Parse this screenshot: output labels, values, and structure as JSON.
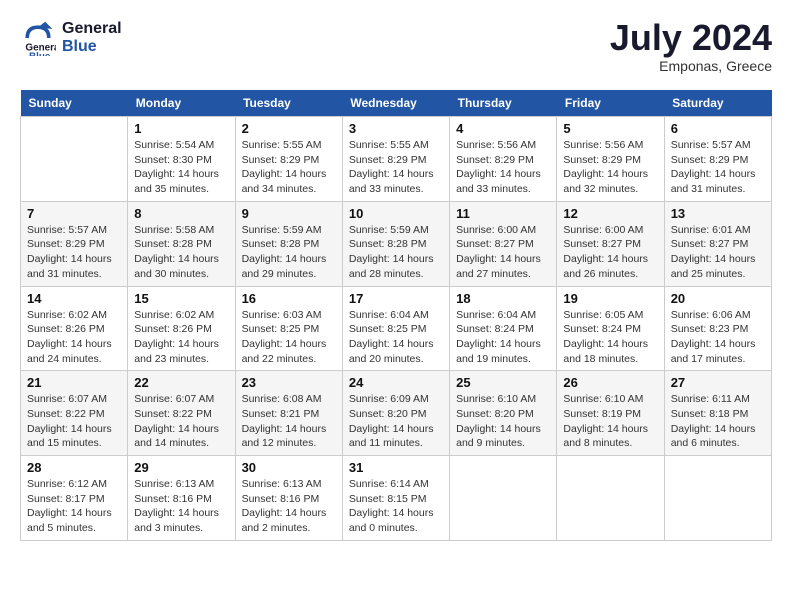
{
  "header": {
    "logo_line1": "General",
    "logo_line2": "Blue",
    "month": "July 2024",
    "location": "Emponas, Greece"
  },
  "columns": [
    "Sunday",
    "Monday",
    "Tuesday",
    "Wednesday",
    "Thursday",
    "Friday",
    "Saturday"
  ],
  "weeks": [
    [
      {
        "num": "",
        "info": ""
      },
      {
        "num": "1",
        "info": "Sunrise: 5:54 AM\nSunset: 8:30 PM\nDaylight: 14 hours\nand 35 minutes."
      },
      {
        "num": "2",
        "info": "Sunrise: 5:55 AM\nSunset: 8:29 PM\nDaylight: 14 hours\nand 34 minutes."
      },
      {
        "num": "3",
        "info": "Sunrise: 5:55 AM\nSunset: 8:29 PM\nDaylight: 14 hours\nand 33 minutes."
      },
      {
        "num": "4",
        "info": "Sunrise: 5:56 AM\nSunset: 8:29 PM\nDaylight: 14 hours\nand 33 minutes."
      },
      {
        "num": "5",
        "info": "Sunrise: 5:56 AM\nSunset: 8:29 PM\nDaylight: 14 hours\nand 32 minutes."
      },
      {
        "num": "6",
        "info": "Sunrise: 5:57 AM\nSunset: 8:29 PM\nDaylight: 14 hours\nand 31 minutes."
      }
    ],
    [
      {
        "num": "7",
        "info": "Sunrise: 5:57 AM\nSunset: 8:29 PM\nDaylight: 14 hours\nand 31 minutes."
      },
      {
        "num": "8",
        "info": "Sunrise: 5:58 AM\nSunset: 8:28 PM\nDaylight: 14 hours\nand 30 minutes."
      },
      {
        "num": "9",
        "info": "Sunrise: 5:59 AM\nSunset: 8:28 PM\nDaylight: 14 hours\nand 29 minutes."
      },
      {
        "num": "10",
        "info": "Sunrise: 5:59 AM\nSunset: 8:28 PM\nDaylight: 14 hours\nand 28 minutes."
      },
      {
        "num": "11",
        "info": "Sunrise: 6:00 AM\nSunset: 8:27 PM\nDaylight: 14 hours\nand 27 minutes."
      },
      {
        "num": "12",
        "info": "Sunrise: 6:00 AM\nSunset: 8:27 PM\nDaylight: 14 hours\nand 26 minutes."
      },
      {
        "num": "13",
        "info": "Sunrise: 6:01 AM\nSunset: 8:27 PM\nDaylight: 14 hours\nand 25 minutes."
      }
    ],
    [
      {
        "num": "14",
        "info": "Sunrise: 6:02 AM\nSunset: 8:26 PM\nDaylight: 14 hours\nand 24 minutes."
      },
      {
        "num": "15",
        "info": "Sunrise: 6:02 AM\nSunset: 8:26 PM\nDaylight: 14 hours\nand 23 minutes."
      },
      {
        "num": "16",
        "info": "Sunrise: 6:03 AM\nSunset: 8:25 PM\nDaylight: 14 hours\nand 22 minutes."
      },
      {
        "num": "17",
        "info": "Sunrise: 6:04 AM\nSunset: 8:25 PM\nDaylight: 14 hours\nand 20 minutes."
      },
      {
        "num": "18",
        "info": "Sunrise: 6:04 AM\nSunset: 8:24 PM\nDaylight: 14 hours\nand 19 minutes."
      },
      {
        "num": "19",
        "info": "Sunrise: 6:05 AM\nSunset: 8:24 PM\nDaylight: 14 hours\nand 18 minutes."
      },
      {
        "num": "20",
        "info": "Sunrise: 6:06 AM\nSunset: 8:23 PM\nDaylight: 14 hours\nand 17 minutes."
      }
    ],
    [
      {
        "num": "21",
        "info": "Sunrise: 6:07 AM\nSunset: 8:22 PM\nDaylight: 14 hours\nand 15 minutes."
      },
      {
        "num": "22",
        "info": "Sunrise: 6:07 AM\nSunset: 8:22 PM\nDaylight: 14 hours\nand 14 minutes."
      },
      {
        "num": "23",
        "info": "Sunrise: 6:08 AM\nSunset: 8:21 PM\nDaylight: 14 hours\nand 12 minutes."
      },
      {
        "num": "24",
        "info": "Sunrise: 6:09 AM\nSunset: 8:20 PM\nDaylight: 14 hours\nand 11 minutes."
      },
      {
        "num": "25",
        "info": "Sunrise: 6:10 AM\nSunset: 8:20 PM\nDaylight: 14 hours\nand 9 minutes."
      },
      {
        "num": "26",
        "info": "Sunrise: 6:10 AM\nSunset: 8:19 PM\nDaylight: 14 hours\nand 8 minutes."
      },
      {
        "num": "27",
        "info": "Sunrise: 6:11 AM\nSunset: 8:18 PM\nDaylight: 14 hours\nand 6 minutes."
      }
    ],
    [
      {
        "num": "28",
        "info": "Sunrise: 6:12 AM\nSunset: 8:17 PM\nDaylight: 14 hours\nand 5 minutes."
      },
      {
        "num": "29",
        "info": "Sunrise: 6:13 AM\nSunset: 8:16 PM\nDaylight: 14 hours\nand 3 minutes."
      },
      {
        "num": "30",
        "info": "Sunrise: 6:13 AM\nSunset: 8:16 PM\nDaylight: 14 hours\nand 2 minutes."
      },
      {
        "num": "31",
        "info": "Sunrise: 6:14 AM\nSunset: 8:15 PM\nDaylight: 14 hours\nand 0 minutes."
      },
      {
        "num": "",
        "info": ""
      },
      {
        "num": "",
        "info": ""
      },
      {
        "num": "",
        "info": ""
      }
    ]
  ]
}
